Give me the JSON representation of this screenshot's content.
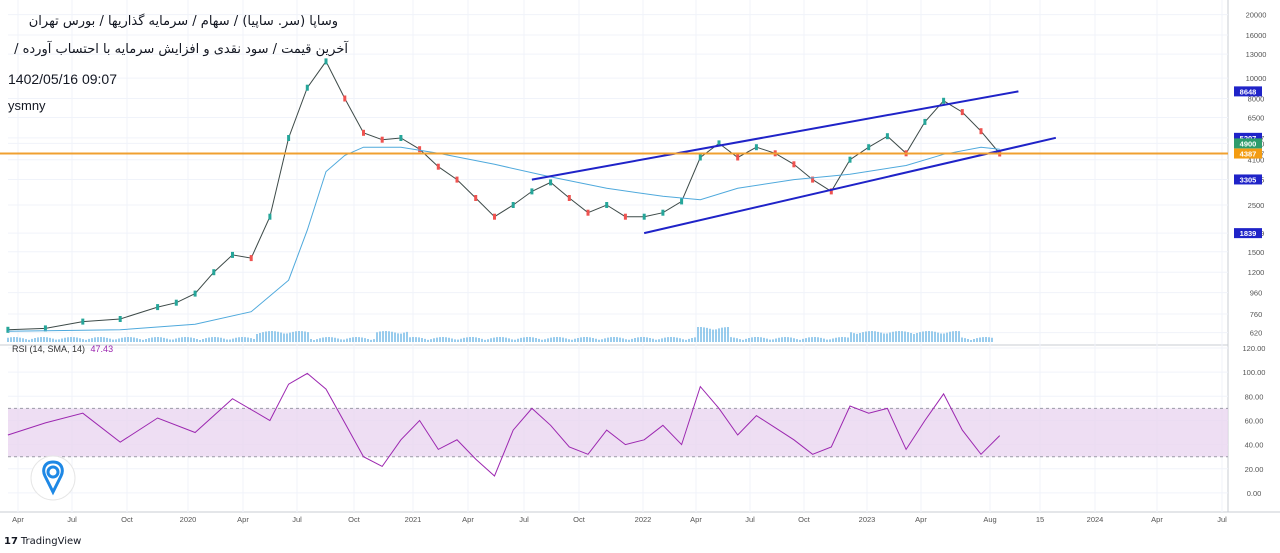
{
  "header": {
    "title_line1": "وساپا (سر. ساپیا) / سهام / سرمایه گذاریها / بورس تهران",
    "title_line2": "آخرین قیمت / سود نقدی و افزایش سرمایه با احتساب آورده /",
    "datetime": "1402/05/16 09:07",
    "author": "ysmny"
  },
  "footer": {
    "brand_mark": "17",
    "brand": "TradingView"
  },
  "colors": {
    "price_candles_up": "#26a69a",
    "price_candles_down": "#ef5350",
    "moving_average": "#4fa9dc",
    "channel_lines": "#1f23c8",
    "support_line": "#f0a030",
    "rsi_line": "#9c27b0",
    "rsi_band": "#ead6f0",
    "volume": "#7fbfe8",
    "label_blue": "#1f23c8",
    "label_green": "#2e9c6c",
    "label_orange": "#f39c12"
  },
  "icons": {
    "logo": "drop-pin-icon"
  },
  "chart_data": [
    {
      "type": "line",
      "title": "",
      "scale": "log",
      "y_ticks": [
        "20000",
        "16000",
        "13000",
        "10000",
        "8000",
        "6500",
        "5207",
        "4900",
        "4387",
        "4100",
        "3305",
        "2500",
        "1839",
        "1500",
        "1200",
        "960",
        "760",
        "620"
      ],
      "price_labels": [
        {
          "value": "8648",
          "color": "#1f23c8"
        },
        {
          "value": "5207",
          "color": "#1f23c8"
        },
        {
          "value": "4900",
          "color": "#2e9c6c"
        },
        {
          "value": "4387",
          "color": "#f39c12"
        },
        {
          "value": "3305",
          "color": "#1f23c8"
        },
        {
          "value": "1839",
          "color": "#1f23c8"
        }
      ],
      "x_ticks": [
        "Apr",
        "Jul",
        "Oct",
        "2020",
        "Apr",
        "Jul",
        "Oct",
        "2021",
        "Apr",
        "Jul",
        "Oct",
        "2022",
        "Apr",
        "Jul",
        "Oct",
        "2023",
        "Apr",
        "Aug",
        "15",
        "2024",
        "Apr",
        "Jul"
      ],
      "series": [
        {
          "values": [
            [
              "2019-03",
              640
            ],
            [
              "2019-05",
              650
            ],
            [
              "2019-07",
              700
            ],
            [
              "2019-09",
              720
            ],
            [
              "2019-11",
              820
            ],
            [
              "2019-12",
              860
            ],
            [
              "2020-01",
              950
            ],
            [
              "2020-02",
              1200
            ],
            [
              "2020-03",
              1450
            ],
            [
              "2020-04",
              1400
            ],
            [
              "2020-05",
              2200
            ],
            [
              "2020-06",
              5200
            ],
            [
              "2020-07",
              9000
            ],
            [
              "2020-08",
              12000
            ],
            [
              "2020-09",
              8000
            ],
            [
              "2020-10",
              5500
            ],
            [
              "2020-11",
              5100
            ],
            [
              "2020-12",
              5200
            ],
            [
              "2021-01",
              4600
            ],
            [
              "2021-02",
              3800
            ],
            [
              "2021-03",
              3300
            ],
            [
              "2021-04",
              2700
            ],
            [
              "2021-05",
              2200
            ],
            [
              "2021-06",
              2500
            ],
            [
              "2021-07",
              2900
            ],
            [
              "2021-08",
              3200
            ],
            [
              "2021-09",
              2700
            ],
            [
              "2021-10",
              2300
            ],
            [
              "2021-11",
              2500
            ],
            [
              "2021-12",
              2200
            ],
            [
              "2022-01",
              2200
            ],
            [
              "2022-02",
              2300
            ],
            [
              "2022-03",
              2600
            ],
            [
              "2022-04",
              4200
            ],
            [
              "2022-05",
              4900
            ],
            [
              "2022-06",
              4200
            ],
            [
              "2022-07",
              4700
            ],
            [
              "2022-08",
              4400
            ],
            [
              "2022-09",
              3900
            ],
            [
              "2022-10",
              3300
            ],
            [
              "2022-11",
              2900
            ],
            [
              "2022-12",
              4100
            ],
            [
              "2023-01",
              4700
            ],
            [
              "2023-02",
              5300
            ],
            [
              "2023-03",
              4400
            ],
            [
              "2023-04",
              6200
            ],
            [
              "2023-05",
              7800
            ],
            [
              "2023-06",
              6900
            ],
            [
              "2023-07",
              5600
            ],
            [
              "2023-08",
              4387
            ]
          ]
        },
        {
          "name_hint": "moving-average",
          "values": [
            [
              "2019-03",
              630
            ],
            [
              "2019-09",
              640
            ],
            [
              "2020-01",
              680
            ],
            [
              "2020-04",
              780
            ],
            [
              "2020-06",
              1100
            ],
            [
              "2020-07",
              1900
            ],
            [
              "2020-08",
              3600
            ],
            [
              "2020-09",
              4300
            ],
            [
              "2020-10",
              4700
            ],
            [
              "2020-12",
              4700
            ],
            [
              "2021-02",
              4400
            ],
            [
              "2021-05",
              3900
            ],
            [
              "2021-08",
              3400
            ],
            [
              "2021-11",
              3000
            ],
            [
              "2022-02",
              2750
            ],
            [
              "2022-04",
              2650
            ],
            [
              "2022-06",
              3000
            ],
            [
              "2022-09",
              3300
            ],
            [
              "2022-12",
              3500
            ],
            [
              "2023-03",
              3850
            ],
            [
              "2023-05",
              4350
            ],
            [
              "2023-07",
              4700
            ],
            [
              "2023-08",
              4600
            ]
          ]
        }
      ],
      "channel": {
        "upper": [
          [
            "2021-07",
            3300
          ],
          [
            "2023-09",
            8648
          ]
        ],
        "lower": [
          [
            "2022-01",
            1839
          ],
          [
            "2023-11",
            5207
          ]
        ]
      },
      "horizontal_line": 4387
    },
    {
      "type": "line",
      "title": "RSI (14, SMA, 14)",
      "last_value": "47.43",
      "y_ticks": [
        "120.00",
        "100.00",
        "80.00",
        "60.00",
        "40.00",
        "20.00",
        "0.00"
      ],
      "bands": [
        30,
        70
      ],
      "ylim": [
        -10,
        120
      ],
      "series": [
        {
          "values": [
            [
              "2019-03",
              48
            ],
            [
              "2019-05",
              58
            ],
            [
              "2019-07",
              66
            ],
            [
              "2019-09",
              42
            ],
            [
              "2019-11",
              62
            ],
            [
              "2020-01",
              50
            ],
            [
              "2020-03",
              78
            ],
            [
              "2020-05",
              60
            ],
            [
              "2020-06",
              90
            ],
            [
              "2020-07",
              99
            ],
            [
              "2020-08",
              86
            ],
            [
              "2020-09",
              58
            ],
            [
              "2020-10",
              30
            ],
            [
              "2020-11",
              22
            ],
            [
              "2020-12",
              44
            ],
            [
              "2021-01",
              60
            ],
            [
              "2021-02",
              36
            ],
            [
              "2021-03",
              44
            ],
            [
              "2021-04",
              28
            ],
            [
              "2021-05",
              14
            ],
            [
              "2021-06",
              52
            ],
            [
              "2021-07",
              70
            ],
            [
              "2021-08",
              56
            ],
            [
              "2021-09",
              38
            ],
            [
              "2021-10",
              32
            ],
            [
              "2021-11",
              52
            ],
            [
              "2021-12",
              40
            ],
            [
              "2022-01",
              44
            ],
            [
              "2022-02",
              56
            ],
            [
              "2022-03",
              40
            ],
            [
              "2022-04",
              88
            ],
            [
              "2022-05",
              70
            ],
            [
              "2022-06",
              48
            ],
            [
              "2022-07",
              64
            ],
            [
              "2022-08",
              54
            ],
            [
              "2022-09",
              44
            ],
            [
              "2022-10",
              32
            ],
            [
              "2022-11",
              38
            ],
            [
              "2022-12",
              72
            ],
            [
              "2023-01",
              66
            ],
            [
              "2023-02",
              70
            ],
            [
              "2023-03",
              36
            ],
            [
              "2023-04",
              60
            ],
            [
              "2023-05",
              82
            ],
            [
              "2023-06",
              52
            ],
            [
              "2023-07",
              32
            ],
            [
              "2023-08",
              47.43
            ]
          ]
        }
      ]
    }
  ]
}
